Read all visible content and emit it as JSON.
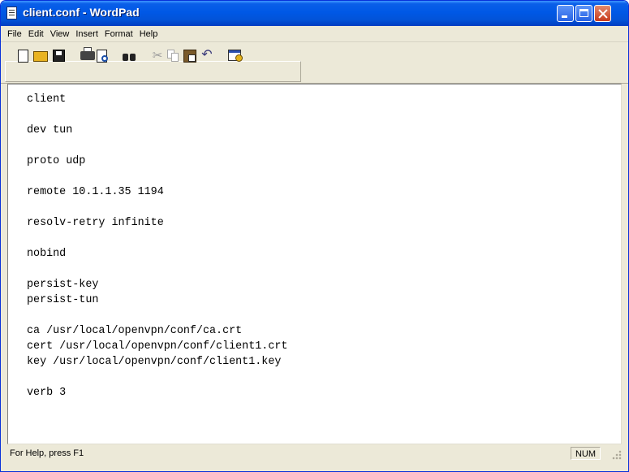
{
  "window": {
    "title": "client.conf - WordPad"
  },
  "menu": [
    "File",
    "Edit",
    "View",
    "Insert",
    "Format",
    "Help"
  ],
  "toolbar": {
    "icons": [
      "new-document-icon",
      "open-folder-icon",
      "save-disk-icon",
      "print-icon",
      "print-preview-icon",
      "find-binoculars-icon",
      "cut-scissors-icon",
      "copy-icon",
      "paste-icon",
      "undo-icon",
      "insert-date-time-icon"
    ]
  },
  "document": {
    "lines": [
      "client",
      "",
      "dev tun",
      "",
      "proto udp",
      "",
      "remote 10.1.1.35 1194",
      "",
      "resolv-retry infinite",
      "",
      "nobind",
      "",
      "persist-key",
      "persist-tun",
      "",
      "ca /usr/local/openvpn/conf/ca.crt",
      "cert /usr/local/openvpn/conf/client1.crt",
      "key /usr/local/openvpn/conf/client1.key",
      "",
      "verb 3"
    ]
  },
  "statusbar": {
    "help_text": "For Help, press F1",
    "num_indicator": "NUM"
  }
}
